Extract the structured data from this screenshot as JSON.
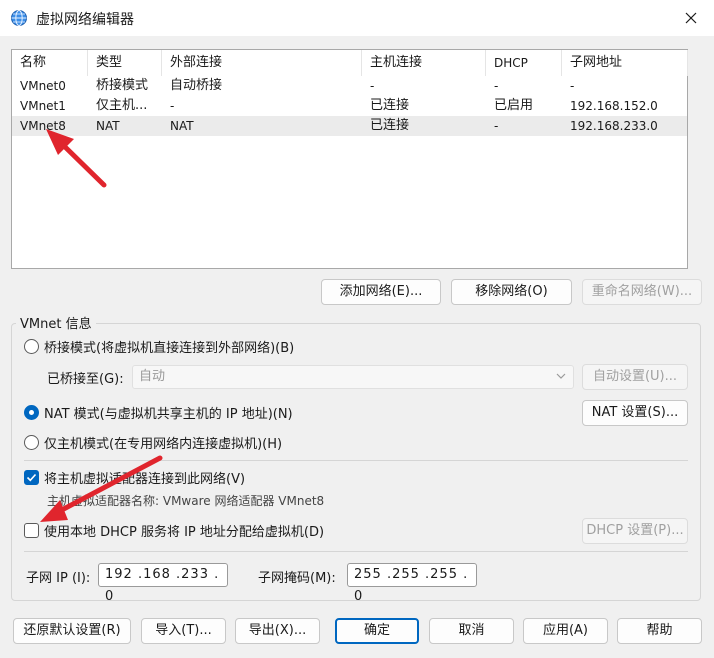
{
  "window": {
    "title": "虚拟网络编辑器",
    "icon": "network-globe-icon"
  },
  "network_list": {
    "columns": [
      "名称",
      "类型",
      "外部连接",
      "主机连接",
      "DHCP",
      "子网地址"
    ],
    "rows": [
      {
        "name": "VMnet0",
        "type": "桥接模式",
        "external": "自动桥接",
        "host": "-",
        "dhcp": "-",
        "subnet": "-"
      },
      {
        "name": "VMnet1",
        "type": "仅主机...",
        "external": "-",
        "host": "已连接",
        "dhcp": "已启用",
        "subnet": "192.168.152.0"
      },
      {
        "name": "VMnet8",
        "type": "NAT",
        "external": "NAT",
        "host": "已连接",
        "dhcp": "-",
        "subnet": "192.168.233.0"
      }
    ],
    "selected_row": "VMnet8"
  },
  "list_buttons": {
    "add": "添加网络(E)...",
    "remove": "移除网络(O)",
    "rename": "重命名网络(W)..."
  },
  "vmnet_info": {
    "title": "VMnet 信息",
    "bridged_label": "桥接模式(将虚拟机直接连接到外部网络)(B)",
    "bridged_to_label": "已桥接至(G):",
    "bridged_to_value": "自动",
    "auto_settings": "自动设置(U)...",
    "nat_label": "NAT 模式(与虚拟机共享主机的 IP 地址)(N)",
    "nat_settings": "NAT 设置(S)...",
    "hostonly_label": "仅主机模式(在专用网络内连接虚拟机)(H)",
    "selected_mode": "nat",
    "connect_adapter_label": "将主机虚拟适配器连接到此网络(V)",
    "connect_adapter_checked": true,
    "adapter_name_label": "主机虚拟适配器名称: VMware 网络适配器 VMnet8",
    "dhcp_label": "使用本地 DHCP 服务将 IP 地址分配给虚拟机(D)",
    "dhcp_checked": false,
    "dhcp_settings": "DHCP 设置(P)...",
    "subnet_ip_label": "子网 IP (I):",
    "subnet_ip_value": "192 .168 .233 .  0",
    "subnet_mask_label": "子网掩码(M):",
    "subnet_mask_value": "255 .255 .255 .  0"
  },
  "footer": {
    "restore": "还原默认设置(R)",
    "import": "导入(T)...",
    "export": "导出(X)...",
    "ok": "确定",
    "cancel": "取消",
    "apply": "应用(A)",
    "help": "帮助"
  },
  "colors": {
    "accent": "#0067c0",
    "annotation_arrow": "#e0252d"
  }
}
